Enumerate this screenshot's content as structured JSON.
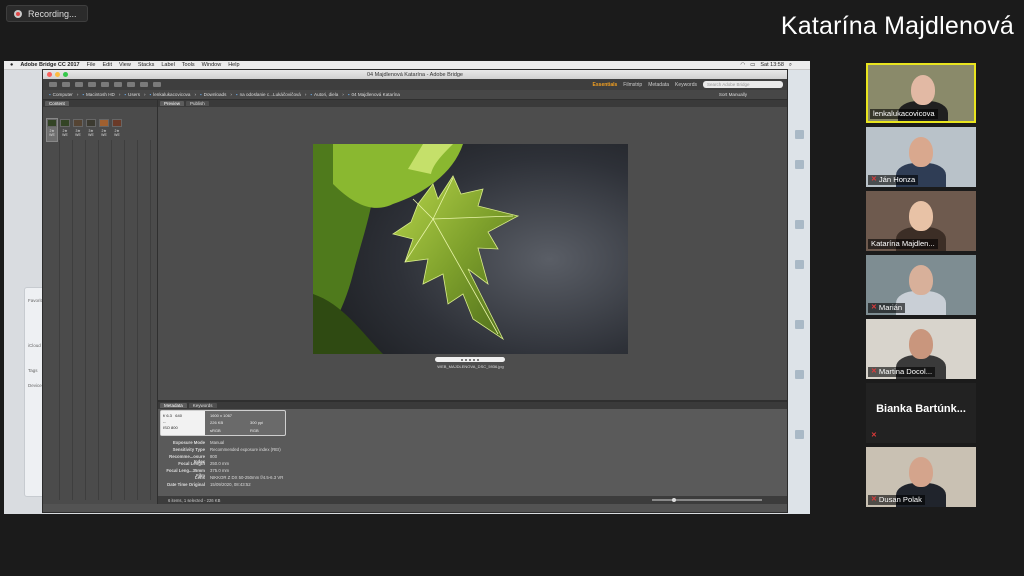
{
  "recording": {
    "label": "Recording..."
  },
  "speaker_name": "Katarína Majdlenová",
  "mac_menubar": {
    "app": "Adobe Bridge CC 2017",
    "menus": [
      "File",
      "Edit",
      "View",
      "Stacks",
      "Label",
      "Tools",
      "Window",
      "Help"
    ],
    "clock": "Sat 13:58"
  },
  "bridge": {
    "window_title": "04 Majdlenová Katarína - Adobe Bridge",
    "workspaces": [
      "Essentials",
      "Filmstrip",
      "Metadata",
      "Keywords"
    ],
    "search_placeholder": "Search Adobe Bridge",
    "path": [
      "Computer",
      "Macintosh HD",
      "Users",
      "lenkalukacovicova",
      "Downloads",
      "na odoslanie c...Lukáčovičová",
      "Autori, diela",
      "04 Majdlenová Katarína"
    ],
    "sort": "Sort Manually",
    "content_tab": "Content",
    "preview_tabs": [
      "Preview",
      "Publish"
    ],
    "thumbnails": [
      "2★ WE",
      "2★ WE",
      "3★ WE",
      "3★ WE",
      "2★ WE",
      "2★ WE"
    ],
    "caption": "WEB_MAJDLENOVA_DSC_5936.jpg",
    "metadata_tabs": [
      "Metadata",
      "Keywords"
    ],
    "placard": {
      "aperture": "f/ 6.3",
      "iso": "640",
      "shutter": "--",
      "iso_label": "ISO 800",
      "dimensions": "1600 x 1067",
      "size": "226 KB",
      "ppi": "300 ppi",
      "color_space": "sRGB",
      "mode": "RGB"
    },
    "meta_rows": [
      {
        "k": "Exposure Mode",
        "v": "Manual"
      },
      {
        "k": "Sensitivity Type",
        "v": "Recommended exposure index (REI)"
      },
      {
        "k": "Recomme...osure Index",
        "v": "800"
      },
      {
        "k": "Focal Length",
        "v": "250.0 mm"
      },
      {
        "k": "Focal Leng...35mm Film",
        "v": "375.0 mm"
      },
      {
        "k": "Lens",
        "v": "NIKKOR Z DX 50-250mm f/4.5-6.3 VR"
      },
      {
        "k": "Date Time Original",
        "v": "15/09/2020, 08:43:52"
      }
    ],
    "status": "6 items, 1 selected - 226 KB"
  },
  "finder": [
    "Favorites",
    "iCloud",
    "Tags",
    "Devices"
  ],
  "participants": [
    {
      "name": "lenkalukacovicova",
      "muted": false,
      "active": true,
      "bg": "#8a8a6a",
      "skin": "#e2b9a4",
      "shirt": "#202020"
    },
    {
      "name": "Ján Honza",
      "muted": true,
      "active": false,
      "bg": "#b9c2c9",
      "skin": "#d9a88e",
      "shirt": "#2f3d55"
    },
    {
      "name": "Katarína Majdlen...",
      "muted": false,
      "active": false,
      "bg": "#6e5a4e",
      "skin": "#e8c2a6",
      "shirt": "#3c2e26"
    },
    {
      "name": "Marián",
      "muted": true,
      "active": false,
      "bg": "#7e8d92",
      "skin": "#d8b09a",
      "shirt": "#c9cfd6"
    },
    {
      "name": "Martina Docol...",
      "muted": true,
      "active": false,
      "bg": "#d8d4cc",
      "skin": "#c9967d",
      "shirt": "#3a3a3a"
    },
    {
      "name": "Bianka Bartúnk...",
      "muted": true,
      "active": false,
      "noimg": true,
      "label_name": "Bianka Bartúnk..."
    },
    {
      "name": "Dusan Polak",
      "muted": true,
      "active": false,
      "bg": "#c9c1b3",
      "skin": "#d4a48c",
      "shirt": "#20242c"
    }
  ]
}
